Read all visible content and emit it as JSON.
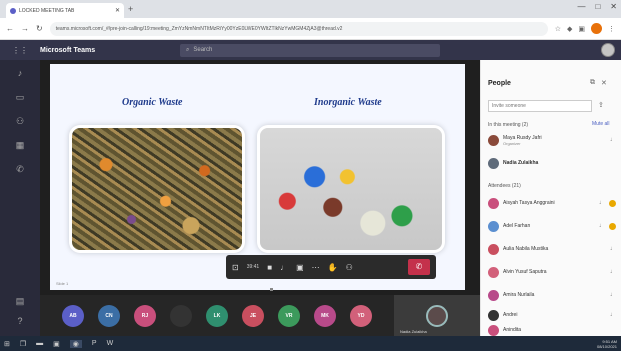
{
  "browser": {
    "tab_title": "LOCKED MEETING TAB",
    "new_tab": "+",
    "window_controls": [
      "—",
      "□",
      "✕"
    ],
    "url": "teams.microsoft.com/_#/pre-join-calling/19:meeting_ZmYzNmNmNTItMzRiYy00YzE0LWE0YWItZTlkNzYwMGM4ZjA3@thread.v2"
  },
  "teams": {
    "app_title": "Microsoft Teams",
    "search_placeholder": "Search"
  },
  "slide": {
    "left_caption": "Organic Waste",
    "right_caption": "Inorganic Waste",
    "slide_number": "Slide 1"
  },
  "controls": {
    "timer": "39:41"
  },
  "participants_strip": [
    {
      "initials": "AB",
      "color": "#5b5fc7"
    },
    {
      "initials": "CN",
      "color": "#3b6ea5"
    },
    {
      "initials": "RJ",
      "color": "#c94f7c"
    },
    {
      "initials": "",
      "color": "#333333"
    },
    {
      "initials": "LK",
      "color": "#2f8f6f"
    },
    {
      "initials": "JE",
      "color": "#c94f5f"
    },
    {
      "initials": "VR",
      "color": "#3c9a5c"
    },
    {
      "initials": "MK",
      "color": "#b84a8a"
    },
    {
      "initials": "YD",
      "color": "#d2607a"
    }
  ],
  "self_tile": {
    "label": "Nadia Zulaikha"
  },
  "people": {
    "title": "People",
    "invite_placeholder": "Invite someone",
    "in_meeting_label": "In this meeting (2)",
    "mute_all": "Mute all",
    "presenters": [
      {
        "name": "Maya Rusdy Jafri",
        "sub": "Organizer",
        "color": "#8a4a3a"
      },
      {
        "name": "Nadia Zulaikha",
        "sub": "",
        "color": "#5f6b7a"
      }
    ],
    "attendees_label": "Attendees (21)",
    "attendees": [
      {
        "name": "Aisyah Tasya Anggraini",
        "color": "#c94f7c",
        "hand": true
      },
      {
        "name": "Adel Farhan",
        "color": "#5b8fd0",
        "hand": true
      },
      {
        "name": "Aulia Nabila Mustika",
        "color": "#c94f5f",
        "hand": false
      },
      {
        "name": "Alvin Yusuf Saputra",
        "color": "#d2607a",
        "hand": false
      },
      {
        "name": "Amira Nurlaila",
        "color": "#b84a8a",
        "hand": false
      },
      {
        "name": "Andrei",
        "color": "#333333",
        "hand": false
      },
      {
        "name": "Anindita",
        "color": "#c94f7c",
        "hand": false
      }
    ]
  },
  "taskbar": {
    "time": "9:51 AM",
    "date": "08/10/2021"
  }
}
